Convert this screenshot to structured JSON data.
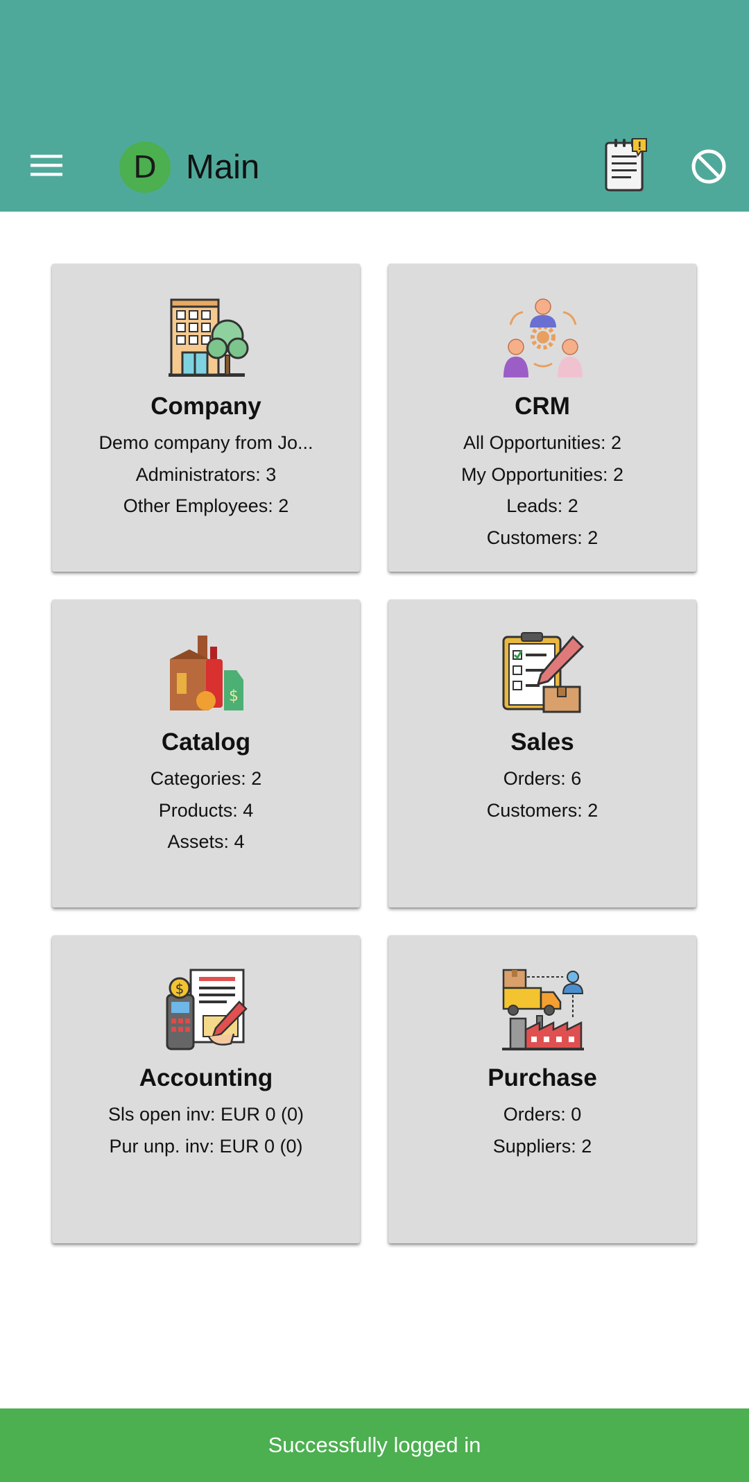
{
  "header": {
    "avatar_letter": "D",
    "title": "Main",
    "menu_icon": "hamburger-menu-icon",
    "notes_icon": "notes-clipboard-icon",
    "block_icon": "block-circle-icon",
    "color": "#4fa99a"
  },
  "cards": [
    {
      "title": "Company",
      "icon": "company-building-icon",
      "lines": [
        "Demo company from Jo...",
        "Administrators: 3",
        "Other Employees: 2"
      ]
    },
    {
      "title": "CRM",
      "icon": "crm-people-icon",
      "lines": [
        "All Opportunities: 2",
        "My Opportunities: 2",
        "Leads: 2",
        "Customers: 2"
      ]
    },
    {
      "title": "Catalog",
      "icon": "catalog-products-icon",
      "lines": [
        "Categories: 2",
        "Products: 4",
        "Assets: 4"
      ]
    },
    {
      "title": "Sales",
      "icon": "sales-clipboard-icon",
      "lines": [
        "Orders: 6",
        "Customers: 2"
      ]
    },
    {
      "title": "Accounting",
      "icon": "accounting-invoice-icon",
      "lines": [
        "Sls open inv: EUR 0 (0)",
        "Pur unp. inv: EUR 0 (0)"
      ]
    },
    {
      "title": "Purchase",
      "icon": "purchase-truck-icon",
      "lines": [
        "Orders: 0",
        "Suppliers: 2"
      ]
    }
  ],
  "snackbar": {
    "message": "Successfully logged in",
    "color": "#4caf50"
  }
}
